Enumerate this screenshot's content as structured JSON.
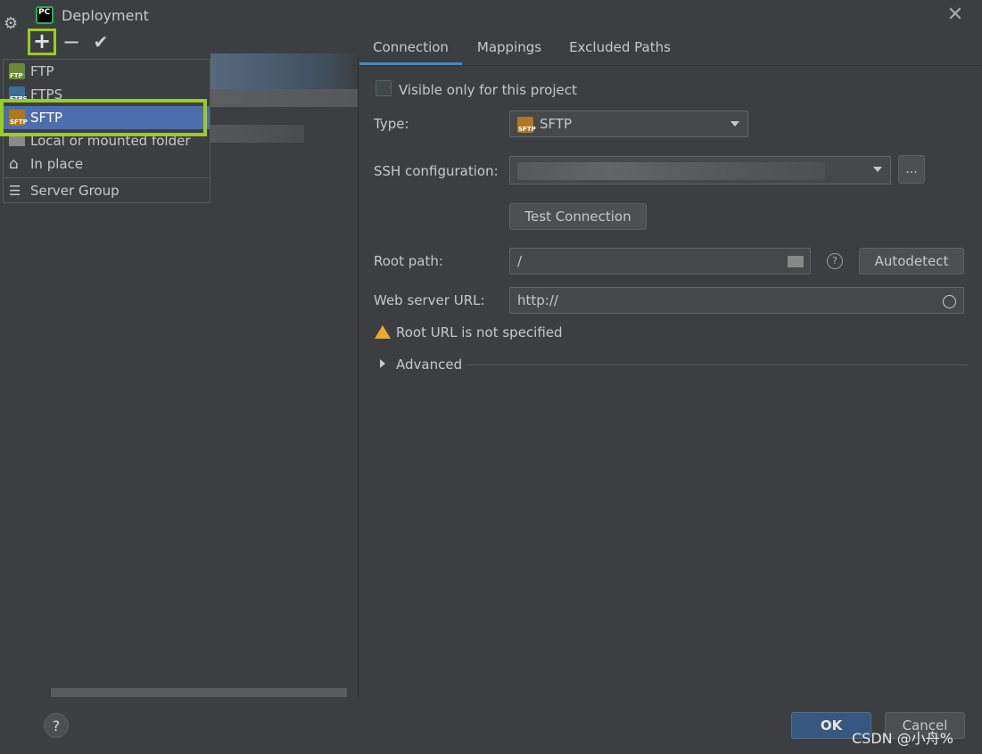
{
  "window": {
    "title": "Deployment"
  },
  "toolbar": {
    "add": "+",
    "remove": "−",
    "apply": "✔"
  },
  "add_menu": {
    "items": [
      {
        "label": "FTP",
        "icon": "ftp-server-icon"
      },
      {
        "label": "FTPS",
        "icon": "ftps-server-icon"
      },
      {
        "label": "SFTP",
        "icon": "sftp-server-icon",
        "selected": true
      },
      {
        "label": "Local or mounted folder",
        "icon": "local-folder-icon"
      },
      {
        "label": "In place",
        "icon": "home-icon"
      },
      {
        "label": "Server Group",
        "icon": "server-group-icon"
      }
    ]
  },
  "tabs": [
    {
      "label": "Connection",
      "active": true
    },
    {
      "label": "Mappings",
      "active": false
    },
    {
      "label": "Excluded Paths",
      "active": false
    }
  ],
  "connection": {
    "visible_only_label": "Visible only for this project",
    "visible_only_checked": false,
    "type_label": "Type:",
    "type_value": "SFTP",
    "ssh_label": "SSH configuration:",
    "ssh_more": "...",
    "test_button": "Test Connection",
    "root_label": "Root path:",
    "root_value": "/",
    "autodetect_button": "Autodetect",
    "url_label": "Web server URL:",
    "url_value": "http://",
    "warning": "Root URL is not specified",
    "advanced_label": "Advanced"
  },
  "footer": {
    "help": "?",
    "ok": "OK",
    "cancel": "Cancel"
  },
  "watermark": "CSDN @小舟%",
  "colors": {
    "highlight": "#9acd1e",
    "selection": "#4b6eaf",
    "accent": "#4a88c7",
    "warning": "#f0a732"
  }
}
